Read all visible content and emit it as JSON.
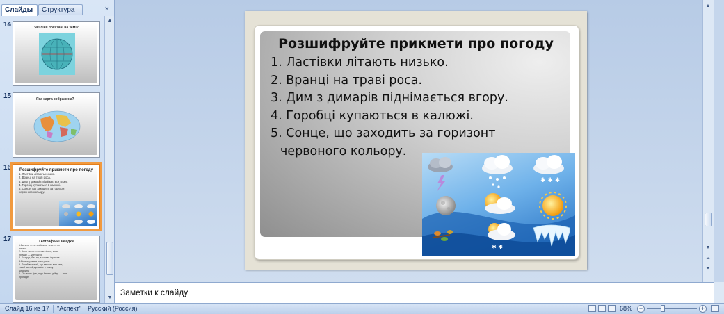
{
  "left_panel": {
    "tabs": [
      {
        "label": "Слайды"
      },
      {
        "label": "Структура"
      }
    ],
    "close_glyph": "×",
    "thumbnails": [
      {
        "number": "14",
        "title": "Які лінії показані на земі?"
      },
      {
        "number": "15",
        "title": "Яка карта зображена?"
      },
      {
        "number": "16",
        "title": "Розшифруйте прикмети про погоду",
        "lines": [
          "1. Ластівки літають низько.",
          "2. Вранці на траві роса.",
          "3. Дим з димарів піднімається вгору.",
          "4. Горобці купаються в калюжі.",
          "5. Сонце, що заходить за горизонт",
          "   червоного кольору."
        ]
      },
      {
        "number": "17",
        "title": "Географічні загадки",
        "lines": [
          "1.Вилить — не вибіжить, тече — не",
          "   витече.",
          "2. Коли чисто — нема нікого, коли",
          "   прийду — усе чисто.",
          "3. Без рук, без ніг, а стукає і грюкає.",
          "4.Біла мурашка вниз розм.",
          "5. Такий великий, що вміщає всю світ,",
          "   такий малий,що влізе у кожну",
          "   шпарину.",
          "6. По морю йде, а до берега дійде — зник",
          "   пропаде."
        ]
      }
    ]
  },
  "slide": {
    "title": "Розшифруйте прикмети про погоду",
    "items": [
      "1. Ластівки літають низько.",
      "2. Вранці на траві роса.",
      "3. Дим з димарів піднімається вгору.",
      "4. Горобці купаються в калюжі.",
      "5. Сонце, що заходить за горизонт"
    ],
    "item5_continuation": "червоного кольору.",
    "image_icons": [
      "storm-cloud-icon",
      "snow-cloud-icon",
      "snow-cloud-icon",
      "lightning-icon",
      "rain-snow-cloud-icon",
      "hail-cloud-icon",
      "moon-icon",
      "sun-behind-cloud-icon",
      "sun-icon",
      "leaves-icon",
      "snow-sun-cloud-icon",
      "icicles-icon"
    ]
  },
  "notes": {
    "placeholder": "Заметки к слайду"
  },
  "status_bar": {
    "slide_info": "Слайд 16 из 17",
    "theme": "\"Аспект\"",
    "language": "Русский (Россия)",
    "zoom": "68%"
  },
  "colors": {
    "selected_thumbnail": "#f19a3f",
    "office_blue": "#c5d6ec"
  }
}
